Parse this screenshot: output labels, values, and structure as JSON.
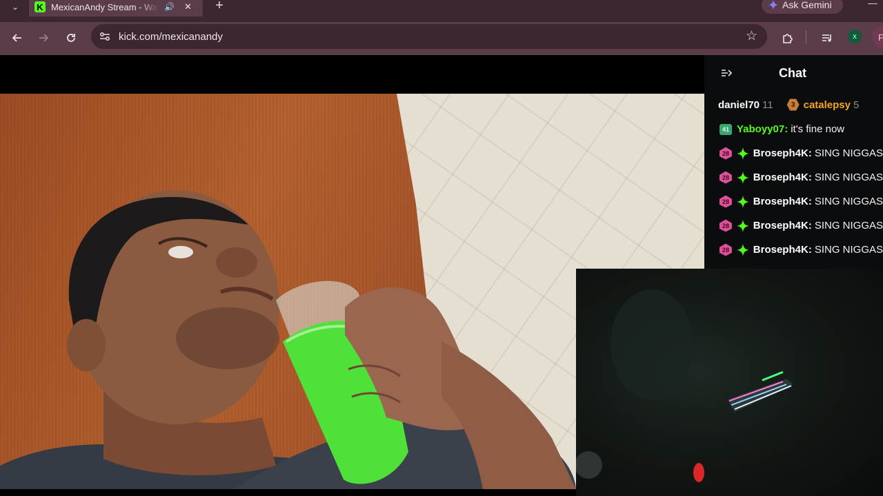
{
  "browser": {
    "tab": {
      "title": "MexicanAndy Stream - Watch Live on Kick",
      "favicon_letter": "K",
      "audio_icon": "speaker-icon",
      "close_icon": "close-icon"
    },
    "ask_gemini_label": "Ask Gemini",
    "url": "kick.com/mexicanandy",
    "extension_badge": "x",
    "profile_initial": "F",
    "colors": {
      "tabstrip": "#3c2632",
      "toolbar": "#5a3c4a",
      "kick_green": "#53fc18"
    }
  },
  "chat": {
    "title": "Chat",
    "gifters": [
      {
        "name": "daniel70",
        "count": "11"
      },
      {
        "name": "catalepsy",
        "count": "5",
        "badge": "3"
      }
    ],
    "messages": [
      {
        "badge": "41",
        "badge_style": "green",
        "user": "Yaboyy07",
        "text": "it's fine now"
      },
      {
        "badge": "28",
        "badge_style": "pink",
        "user": "Broseph4K",
        "text": "SING NIGGAS"
      },
      {
        "badge": "28",
        "badge_style": "pink",
        "user": "Broseph4K",
        "text": "SING NIGGAS"
      },
      {
        "badge": "28",
        "badge_style": "pink",
        "user": "Broseph4K",
        "text": "SING NIGGAS"
      },
      {
        "badge": "28",
        "badge_style": "pink",
        "user": "Broseph4K",
        "text": "SING NIGGAS"
      },
      {
        "badge": "28",
        "badge_style": "pink",
        "user": "Broseph4K",
        "text": "SING NIGGAS"
      }
    ]
  },
  "video": {
    "description_icon": "livestream-video",
    "pip_icon": "picture-in-picture-camera"
  }
}
